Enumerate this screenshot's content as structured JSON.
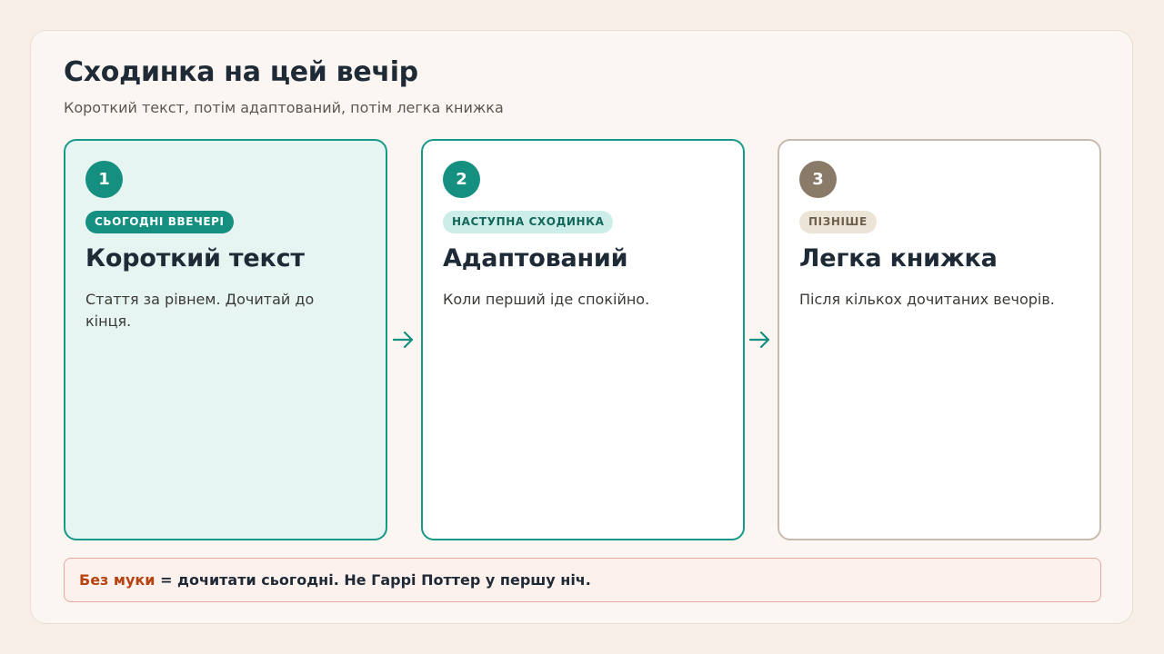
{
  "header": {
    "title": "Сходинка на цей вечір",
    "subtitle": "Короткий текст, потім адаптований, потім легка книжка"
  },
  "steps": [
    {
      "number": "1",
      "badge": "СЬОГОДНІ ВВЕЧЕРІ",
      "title": "Короткий текст",
      "description": "Стаття за рівнем. Дочитай до кінця.",
      "state": "current"
    },
    {
      "number": "2",
      "badge": "НАСТУПНА СХОДИНКА",
      "title": "Адаптований",
      "description": "Коли перший іде спокійно.",
      "state": "next"
    },
    {
      "number": "3",
      "badge": "ПІЗНІШЕ",
      "title": "Легка книжка",
      "description": "Після кількох дочитаних вечорів.",
      "state": "later"
    }
  ],
  "note": {
    "accent": "Без муки",
    "text": " = дочитати сьогодні. Не Гаррі Поттер у першу ніч."
  },
  "icons": {
    "arrow_1": "arrow-right-icon",
    "arrow_2": "arrow-right-icon"
  },
  "colors": {
    "teal": "#148f80",
    "muted_brown": "#8a7b69",
    "accent_orange": "#b74311",
    "current_card_bg": "#e6f5f1"
  }
}
